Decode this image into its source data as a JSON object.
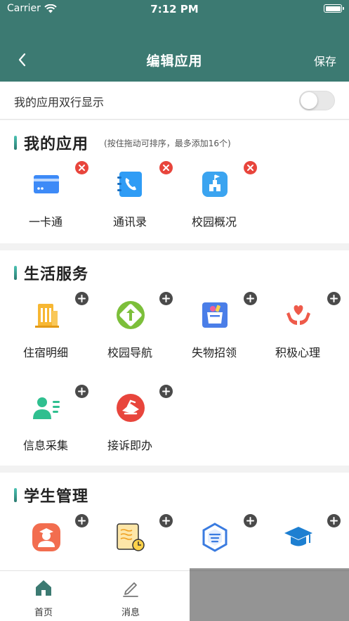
{
  "status": {
    "carrier": "Carrier",
    "time": "7:12 PM"
  },
  "nav": {
    "title": "编辑应用",
    "save": "保存"
  },
  "toggle_row": {
    "label": "我的应用双行显示",
    "enabled": false
  },
  "my_apps": {
    "title": "我的应用",
    "hint": "(按住拖动可排序，最多添加16个)",
    "items": [
      {
        "label": "一卡通",
        "icon": "card-icon"
      },
      {
        "label": "通讯录",
        "icon": "phonebook-icon"
      },
      {
        "label": "校园概况",
        "icon": "campus-icon"
      }
    ]
  },
  "life_services": {
    "title": "生活服务",
    "items": [
      {
        "label": "住宿明细",
        "icon": "dorm-icon"
      },
      {
        "label": "校园导航",
        "icon": "navigation-icon"
      },
      {
        "label": "失物招领",
        "icon": "lost-found-icon"
      },
      {
        "label": "积极心理",
        "icon": "heart-hands-icon"
      },
      {
        "label": "信息采集",
        "icon": "user-info-icon"
      },
      {
        "label": "接诉即办",
        "icon": "complaint-icon"
      }
    ]
  },
  "student_mgmt": {
    "title": "学生管理",
    "items": [
      {
        "label": "",
        "icon": "graduate-icon"
      },
      {
        "label": "",
        "icon": "notebook-clock-icon"
      },
      {
        "label": "",
        "icon": "school-badge-icon"
      },
      {
        "label": "",
        "icon": "mortarboard-icon"
      }
    ]
  },
  "tabs": [
    {
      "label": "首页",
      "icon": "home-icon"
    },
    {
      "label": "消息",
      "icon": "edit-icon"
    }
  ],
  "colors": {
    "header": "#3c7a72",
    "remove": "#e8453c",
    "add": "#4a4a4a"
  }
}
